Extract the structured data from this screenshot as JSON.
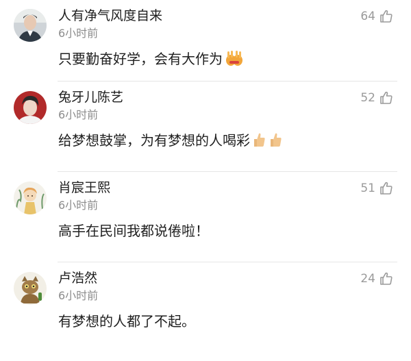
{
  "comments": [
    {
      "username": "人有净气风度自来",
      "time": "6小时前",
      "text": "只要勤奋好学，会有大作为",
      "likes": "64",
      "emoji": "victory-hands"
    },
    {
      "username": "兔牙儿陈艺",
      "time": "6小时前",
      "text": "给梦想鼓掌，为有梦想的人喝彩",
      "likes": "52",
      "emoji": "thumbs-up x2"
    },
    {
      "username": "肖宸王熙",
      "time": "6小时前",
      "text": "高手在民间我都说倦啦！",
      "likes": "51"
    },
    {
      "username": "卢浩然",
      "time": "6小时前",
      "text": "有梦想的人都了不起。",
      "likes": "24"
    }
  ],
  "icons": {
    "like": "thumbs-up-outline-icon"
  },
  "colors": {
    "text": "#1f1f1f",
    "meta": "#8c8c8c",
    "divider": "#e6e6e6",
    "like": "#9a9a9a"
  }
}
